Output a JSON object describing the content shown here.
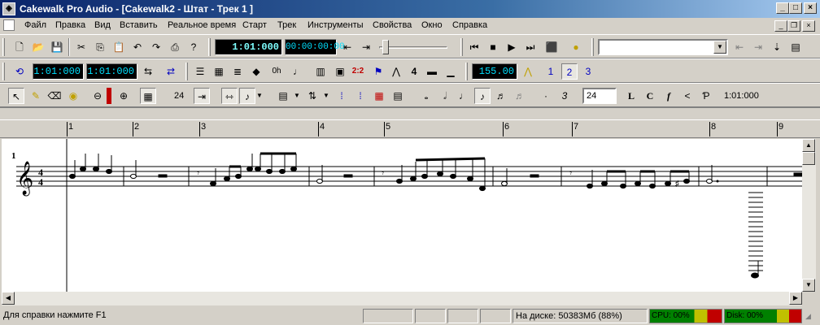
{
  "window": {
    "title": "Cakewalk Pro Audio - [Cakewalk2 - Штат - Трек 1 ]",
    "icon": "app-icon",
    "minimize": "_",
    "maximize": "□",
    "close": "×"
  },
  "menu": {
    "items": [
      "Файл",
      "Правка",
      "Вид",
      "Вставить",
      "Реальное время",
      "Старт",
      "Трек",
      "Инструменты",
      "Свойства",
      "Окно",
      "Справка"
    ]
  },
  "transport": {
    "now_time": "1:01:000",
    "smpte_time": "00:00:00:00",
    "combo_value": ""
  },
  "loop": {
    "from": "1:01:000",
    "thru": "1:01:000",
    "tempo": "155.00"
  },
  "staff_toolbar": {
    "resolution": "24",
    "tuplet_value": "24",
    "position": "1:01:000",
    "label_l": "L",
    "label_c": "C",
    "label_f": "f",
    "label_p": "Ƥ",
    "triplet": "3",
    "dot": "·"
  },
  "ruler": {
    "measures": [
      "1",
      "2",
      "3",
      "4",
      "5",
      "6",
      "7",
      "8",
      "9"
    ]
  },
  "staff": {
    "measure_number": "1",
    "time_sig_top": "4",
    "time_sig_bottom": "4"
  },
  "status": {
    "help": "Для справки нажмите F1",
    "disk": "На диске: 50383Мб (88%)",
    "cpu": "CPU: 00%",
    "disk_meter": "Disk: 00%"
  },
  "colors": {
    "title_gradient_start": "#0a246a",
    "lcd_bg": "#000000",
    "lcd_text": "#00e0ff",
    "meter_green": "#008000",
    "meter_yellow": "#c0c000",
    "meter_red": "#c00000"
  }
}
